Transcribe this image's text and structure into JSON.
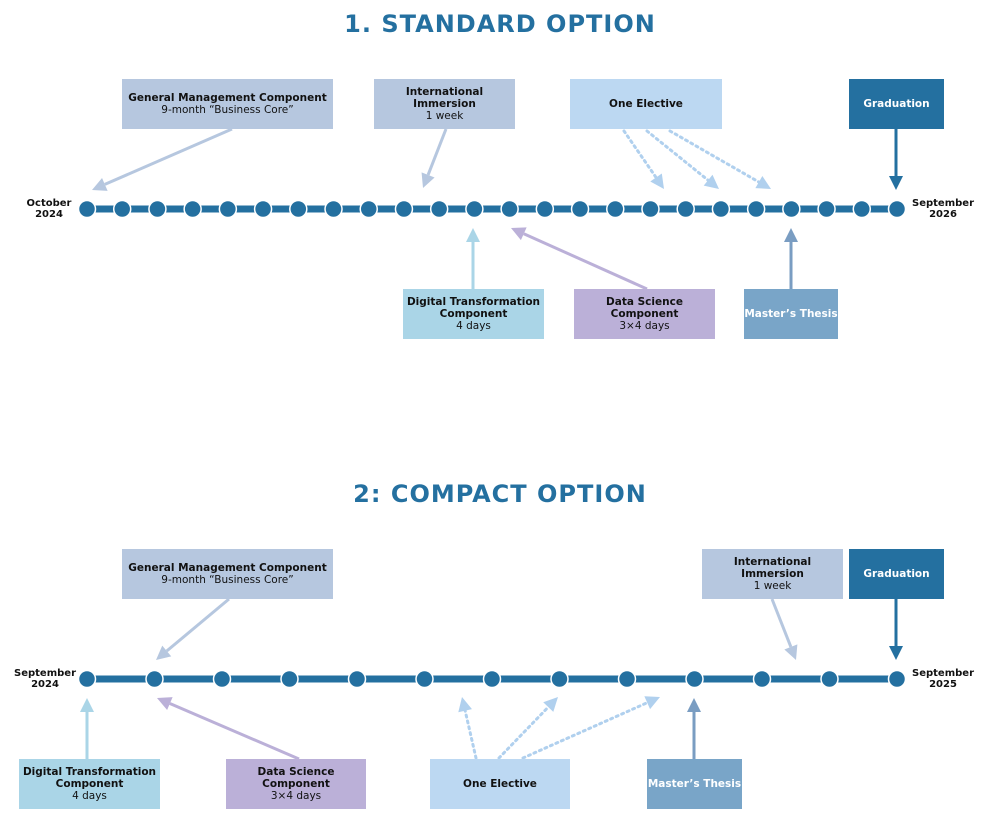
{
  "colors": {
    "timeline": "#2470a0",
    "gm": "#b6c7df",
    "intl": "#b6c7df",
    "elective": "#bcd8f2",
    "graduation": "#2470a0",
    "digital": "#aad5e7",
    "datascience": "#bbb0d8",
    "thesis": "#79a5c8",
    "gm_arrow": "#b6c7df",
    "intl_arrow": "#b6c7df",
    "elective_arrow": "#b0d0ee",
    "digital_arrow": "#aad5e7",
    "datascience_arrow": "#bbb0d8",
    "thesis_arrow": "#7a9dc2"
  },
  "standard": {
    "title": "1. STANDARD OPTION",
    "start": {
      "month": "October",
      "year": "2024"
    },
    "end": {
      "month": "September",
      "year": "2026"
    },
    "months": 24,
    "boxes": {
      "gm": {
        "title": "General Management Component",
        "sub": "9-month “Business Core”"
      },
      "intl": {
        "title1": "International",
        "title2": "Immersion",
        "sub": "1 week"
      },
      "elective": {
        "title": "One Elective"
      },
      "graduation": {
        "title": "Graduation"
      },
      "digital": {
        "title1": "Digital Transformation",
        "title2": "Component",
        "sub": "4 days"
      },
      "datascience": {
        "title1": "Data Science",
        "title2": "Component",
        "sub": "3×4 days"
      },
      "thesis": {
        "title": "Master’s Thesis"
      }
    }
  },
  "compact": {
    "title": "2: COMPACT OPTION",
    "start": {
      "month": "September",
      "year": "2024"
    },
    "end": {
      "month": "September",
      "year": "2025"
    },
    "months": 13,
    "boxes": {
      "gm": {
        "title": "General Management Component",
        "sub": "9-month “Business Core”"
      },
      "intl": {
        "title1": "International",
        "title2": "Immersion",
        "sub": "1 week"
      },
      "graduation": {
        "title": "Graduation"
      },
      "digital": {
        "title1": "Digital Transformation",
        "title2": "Component",
        "sub": "4 days"
      },
      "datascience": {
        "title1": "Data Science",
        "title2": "Component",
        "sub": "3×4 days"
      },
      "elective": {
        "title": "One Elective"
      },
      "thesis": {
        "title": "Master’s Thesis"
      }
    }
  }
}
